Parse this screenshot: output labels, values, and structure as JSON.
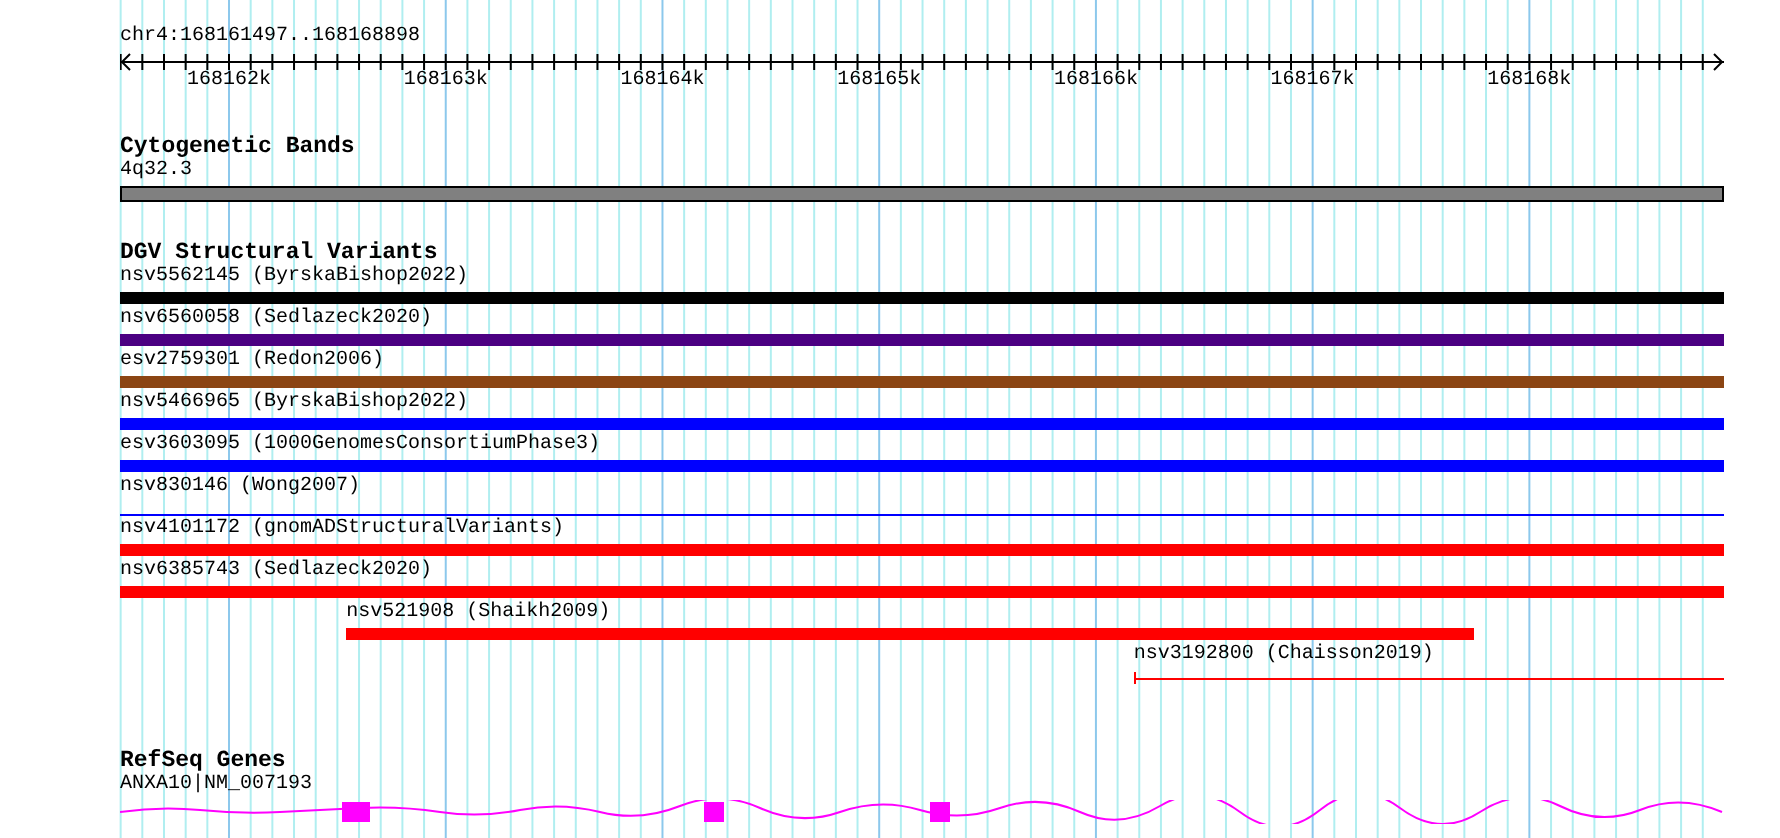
{
  "ruler": {
    "location": "chr4:168161497..168168898",
    "ticks": [
      "168162k",
      "168163k",
      "168164k",
      "168165k",
      "168166k",
      "168167k",
      "168168k"
    ]
  },
  "tracks": [
    {
      "kind": "cytoband",
      "title": "Cytogenetic Bands",
      "features": [
        {
          "label": "4q32.3",
          "kind": "band",
          "color": "#808080"
        }
      ]
    },
    {
      "kind": "variants",
      "title": "DGV Structural Variants",
      "features": [
        {
          "label": "nsv5562145 (ByrskaBishop2022)",
          "kind": "bar",
          "color": "#000000"
        },
        {
          "label": "nsv6560058 (Sedlazeck2020)",
          "kind": "bar",
          "color": "#4b0082"
        },
        {
          "label": "esv2759301 (Redon2006)",
          "kind": "bar",
          "color": "#8b4513"
        },
        {
          "label": "nsv5466965 (ByrskaBishop2022)",
          "kind": "bar",
          "color": "#0000ff"
        },
        {
          "label": "esv3603095 (1000GenomesConsortiumPhase3)",
          "kind": "bar",
          "color": "#0000ff"
        },
        {
          "label": "nsv830146 (Wong2007)",
          "kind": "line",
          "color": "#0000ff"
        },
        {
          "label": "nsv4101172 (gnomADStructuralVariants)",
          "kind": "bar",
          "color": "#ff0000"
        },
        {
          "label": "nsv6385743 (Sedlazeck2020)",
          "kind": "bar",
          "color": "#ff0000"
        },
        {
          "label": "nsv521908 (Shaikh2009)",
          "kind": "bar",
          "color": "#ff0000"
        },
        {
          "label": "nsv3192800 (Chaisson2019)",
          "kind": "line",
          "color": "#ff0000"
        }
      ]
    },
    {
      "kind": "genes",
      "title": "RefSeq Genes",
      "features": [
        {
          "label": "ANXA10|NM_007193",
          "kind": "gene",
          "color": "#ff00ff"
        }
      ]
    }
  ]
}
